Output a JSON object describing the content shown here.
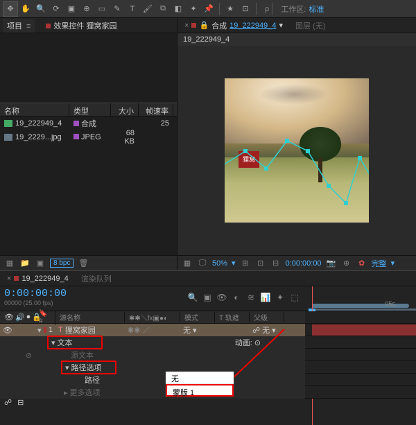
{
  "toolbar": {
    "workspace_label": "工作区:",
    "workspace_value": "标准",
    "search": "ρ"
  },
  "project": {
    "tabs": {
      "project": "项目",
      "effects": "效果控件 狸窝家园"
    },
    "columns": {
      "name": "名称",
      "type": "类型",
      "size": "大小",
      "fps": "帧速率"
    },
    "rows": [
      {
        "name": "19_222949_4",
        "type": "合成",
        "size": "",
        "fps": "25"
      },
      {
        "name": "19_2229...jpg",
        "type": "JPEG",
        "size": "68 KB",
        "fps": ""
      }
    ],
    "bpc": "8 bpc"
  },
  "viewer": {
    "tab1": "合成",
    "tab1_link": "19_222949_4",
    "tab2": "图层 (无)",
    "subtab": "19_222949_4",
    "footer": {
      "zoom": "50%",
      "time": "0:00:00:00",
      "quality": "完整"
    }
  },
  "timeline": {
    "tabs": {
      "comp": "19_222949_4",
      "render": "渲染队列"
    },
    "timecode": "0:00:00:00",
    "timecode_sub": "00000 (25.00 fps)",
    "col": {
      "source": "源名称",
      "mode": "模式",
      "trkmat": "T 轨遮",
      "parent": "父级"
    },
    "ruler_mark": "05s",
    "layer": {
      "index": "1",
      "name": "狸窝家园",
      "mode": "无",
      "parent": "无"
    },
    "props": {
      "text": "文本",
      "anim": "动画:",
      "source_text": "源文本",
      "path_options": "路径选项",
      "path": "路径",
      "path_val": "无",
      "more_options": "更多选项"
    },
    "dropdown": {
      "none": "无",
      "mask1": "蒙版 1"
    }
  }
}
